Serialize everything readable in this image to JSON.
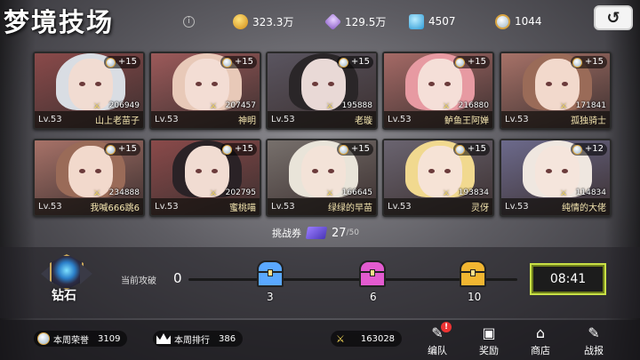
{
  "header": {
    "title": "梦境技场",
    "info_icon": "i",
    "resources": [
      {
        "icon": "coin-icon",
        "value": "323.3万"
      },
      {
        "icon": "crystal-icon",
        "value": "129.5万"
      },
      {
        "icon": "diamond-icon",
        "value": "4507"
      },
      {
        "icon": "medal-icon",
        "value": "1044"
      }
    ],
    "back_icon": "↺"
  },
  "cards": [
    {
      "level": "Lv.53",
      "name": "山上老苗子",
      "power": "206949",
      "bonus": "+15",
      "bg": "#8a4a4a",
      "hair": "#d9dde3",
      "skin": "#f1dcd2"
    },
    {
      "level": "Lv.53",
      "name": "神明",
      "power": "207457",
      "bonus": "+15",
      "bg": "#9c5a5a",
      "hair": "#e8c9b8",
      "skin": "#f3ddd4"
    },
    {
      "level": "Lv.53",
      "name": "老璇",
      "power": "195888",
      "bonus": "+15",
      "bg": "#5a5560",
      "hair": "#2a2628",
      "skin": "#e9d9d6"
    },
    {
      "level": "Lv.53",
      "name": "鲈鱼王阿婵",
      "power": "216880",
      "bonus": "+15",
      "bg": "#a56a66",
      "hair": "#e79aa2",
      "skin": "#f5dfd8"
    },
    {
      "level": "Lv.53",
      "name": "孤独骑士",
      "power": "171841",
      "bonus": "+15",
      "bg": "#a77268",
      "hair": "#9a6b58",
      "skin": "#f2d9cc"
    },
    {
      "level": "Lv.53",
      "name": "我喊666跳6",
      "power": "234888",
      "bonus": "+15",
      "bg": "#a77268",
      "hair": "#9a6b58",
      "skin": "#f2d9cc"
    },
    {
      "level": "Lv.53",
      "name": "蜜桃喵",
      "power": "202795",
      "bonus": "+15",
      "bg": "#8a4a4a",
      "hair": "#2a2226",
      "skin": "#f1dcd2"
    },
    {
      "level": "Lv.53",
      "name": "绿绿的早苗",
      "power": "166645",
      "bonus": "+15",
      "bg": "#77706c",
      "hair": "#e9e4d9",
      "skin": "#f3e3d8"
    },
    {
      "level": "Lv.53",
      "name": "灵伢",
      "power": "193834",
      "bonus": "+15",
      "bg": "#6a6470",
      "hair": "#f1d98f",
      "skin": "#f6e3d6"
    },
    {
      "level": "Lv.53",
      "name": "纯情的大佬",
      "power": "114834",
      "bonus": "+12",
      "bg": "#6c6a8c",
      "hair": "#efe7e0",
      "skin": "#f5e5dc"
    }
  ],
  "tickets": {
    "label": "挑战券",
    "count": "27",
    "max": "/50"
  },
  "progress": {
    "rank": "钻石",
    "label": "当前攻破",
    "value": "0",
    "fill_fraction": 0.0,
    "chests": [
      {
        "label": "3",
        "color": "#5aa8ff"
      },
      {
        "label": "6",
        "color": "#e35bd0"
      },
      {
        "label": "10",
        "color": "#f1b631"
      }
    ],
    "timer": "08:41"
  },
  "footer": {
    "honor_label": "本周荣誉",
    "honor_value": "3109",
    "rank_label": "本周排行",
    "rank_value": "386",
    "power_value": "163028",
    "nav": [
      {
        "label": "编队",
        "icon": "formation-icon",
        "badge": "!"
      },
      {
        "label": "奖励",
        "icon": "reward-icon"
      },
      {
        "label": "商店",
        "icon": "shop-icon"
      },
      {
        "label": "战报",
        "icon": "battle-report-icon"
      }
    ]
  }
}
